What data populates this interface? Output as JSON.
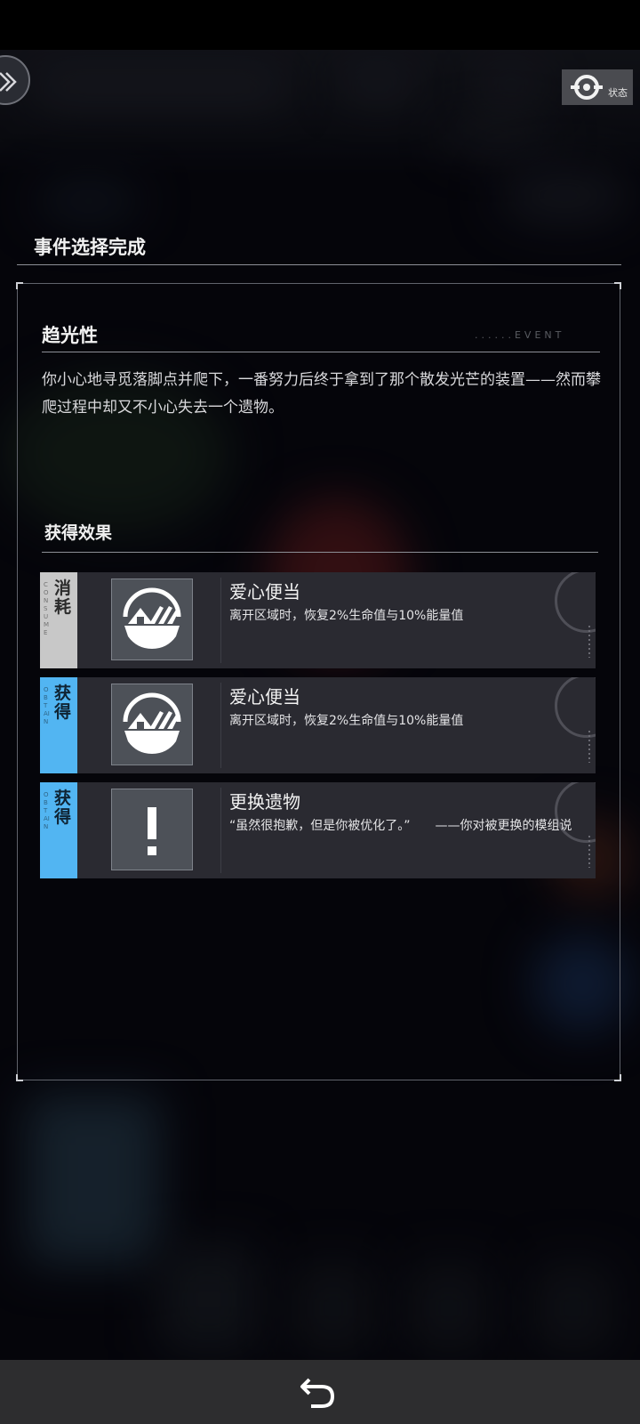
{
  "app": {
    "status_label": "状态"
  },
  "header": {
    "title": "事件选择完成"
  },
  "event": {
    "title": "趋光性",
    "deco": "......EVENT",
    "description": "你小心地寻觅落脚点并爬下，一番努力后终于拿到了那个散发光芒的装置——然而攀爬过程中却又不小心失去一个遗物。"
  },
  "effects": {
    "title": "获得效果",
    "items": [
      {
        "tag": "消耗",
        "tag_en": "CONSUME",
        "type": "consume",
        "icon": "bento-icon",
        "name": "爱心便当",
        "desc": "离开区域时，恢复2%生命值与10%能量值"
      },
      {
        "tag": "获得",
        "tag_en": "OBTAIN",
        "type": "gain",
        "icon": "bento-icon",
        "name": "爱心便当",
        "desc": "离开区域时，恢复2%生命值与10%能量值"
      },
      {
        "tag": "获得",
        "tag_en": "OBTAIN",
        "type": "gain",
        "icon": "exclamation-icon",
        "name": "更换遗物",
        "desc": "“虽然很抱歉，但是你被优化了。”　　——你对被更换的模组说"
      }
    ]
  },
  "colors": {
    "consume": "#c8c8c8",
    "gain": "#52b5f2",
    "card": "#2a2a31"
  }
}
